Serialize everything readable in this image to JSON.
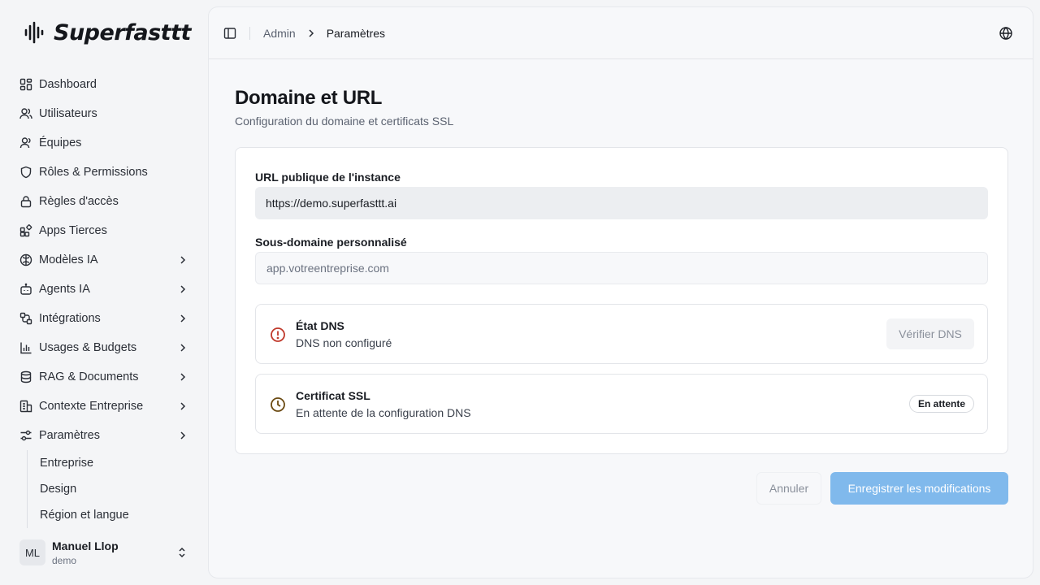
{
  "app": {
    "name": "Superfasttt"
  },
  "sidebar": {
    "items": [
      {
        "label": "Dashboard",
        "icon": "dashboard-icon",
        "expandable": false
      },
      {
        "label": "Utilisateurs",
        "icon": "users-icon",
        "expandable": false
      },
      {
        "label": "Équipes",
        "icon": "team-icon",
        "expandable": false
      },
      {
        "label": "Rôles & Permissions",
        "icon": "shield-icon",
        "expandable": false
      },
      {
        "label": "Règles d'accès",
        "icon": "lock-icon",
        "expandable": false
      },
      {
        "label": "Apps Tierces",
        "icon": "apps-icon",
        "expandable": false
      },
      {
        "label": "Modèles IA",
        "icon": "brain-icon",
        "expandable": true
      },
      {
        "label": "Agents IA",
        "icon": "bot-icon",
        "expandable": true
      },
      {
        "label": "Intégrations",
        "icon": "workflow-icon",
        "expandable": true
      },
      {
        "label": "Usages & Budgets",
        "icon": "bar-chart-icon",
        "expandable": true
      },
      {
        "label": "RAG & Documents",
        "icon": "database-icon",
        "expandable": true
      },
      {
        "label": "Contexte Entreprise",
        "icon": "building-icon",
        "expandable": true
      },
      {
        "label": "Paramètres",
        "icon": "settings-icon",
        "expandable": true
      }
    ],
    "subitems": [
      "Entreprise",
      "Design",
      "Région et langue"
    ]
  },
  "user": {
    "initials": "ML",
    "name": "Manuel Llop",
    "org": "demo"
  },
  "breadcrumb": {
    "parent": "Admin",
    "current": "Paramètres"
  },
  "page": {
    "title": "Domaine et URL",
    "subtitle": "Configuration du domaine et certificats SSL"
  },
  "form": {
    "public_url_label": "URL publique de l'instance",
    "public_url_value": "https://demo.superfasttt.ai",
    "subdomain_label": "Sous-domaine personnalisé",
    "subdomain_placeholder": "app.votreentreprise.com"
  },
  "dns": {
    "title": "État DNS",
    "status": "DNS non configuré",
    "verify_label": "Vérifier DNS",
    "color": "#c0392b"
  },
  "ssl": {
    "title": "Certificat SSL",
    "status": "En attente de la configuration DNS",
    "badge": "En attente",
    "color": "#6b4a12"
  },
  "actions": {
    "cancel": "Annuler",
    "save": "Enregistrer les modifications"
  },
  "colors": {
    "accent": "#80b9ec"
  }
}
